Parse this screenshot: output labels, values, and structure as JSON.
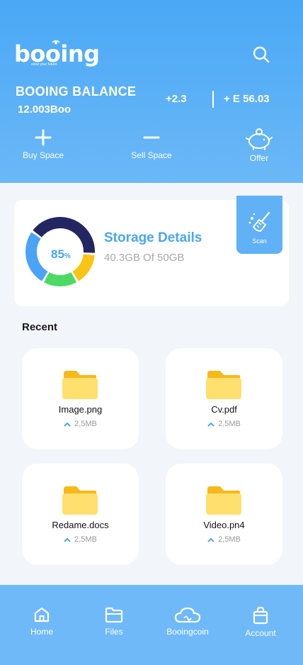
{
  "header": {
    "logo_word": "booing",
    "logo_tagline": "store your future",
    "balance_title": "BOOING BALANCE",
    "balance_value": "12.003Boo",
    "change": "+2.3",
    "amount": "+ E 56.03",
    "search_icon": "search-icon"
  },
  "actions": [
    {
      "label": "Buy Space",
      "icon": "plus-icon"
    },
    {
      "label": "Sell Space",
      "icon": "minus-icon"
    },
    {
      "label": "Offer",
      "icon": "piggy-bank-icon"
    }
  ],
  "storage": {
    "percent": "85",
    "percent_sign": "%",
    "title": "Storage Details",
    "subtitle": "40.3GB Of 50GB",
    "segments_colors": [
      "#232660",
      "#f9c414",
      "#4cd964",
      "#4aa3f5"
    ],
    "scan_label": "Scan",
    "scan_icon": "broom-icon"
  },
  "recent": {
    "heading": "Recent",
    "files": [
      {
        "name": "Image.png",
        "size": "2,5MB"
      },
      {
        "name": "Cv.pdf",
        "size": "2,5MB"
      },
      {
        "name": "Redame.docs",
        "size": "2,5MB"
      },
      {
        "name": "Video.pn4",
        "size": "2,5MB"
      }
    ]
  },
  "nav": [
    {
      "label": "Home",
      "icon": "home-icon"
    },
    {
      "label": "Files",
      "icon": "folder-icon"
    },
    {
      "label": "Booingcoin",
      "icon": "cloud-icon"
    },
    {
      "label": "Account",
      "icon": "bag-icon"
    }
  ],
  "colors": {
    "header_blue": "#4aa8f5",
    "accent": "#49a6f2",
    "folder_yellow": "#ffdf6e",
    "folder_tab": "#f8b819",
    "nav_blue": "#6fb9f8"
  }
}
